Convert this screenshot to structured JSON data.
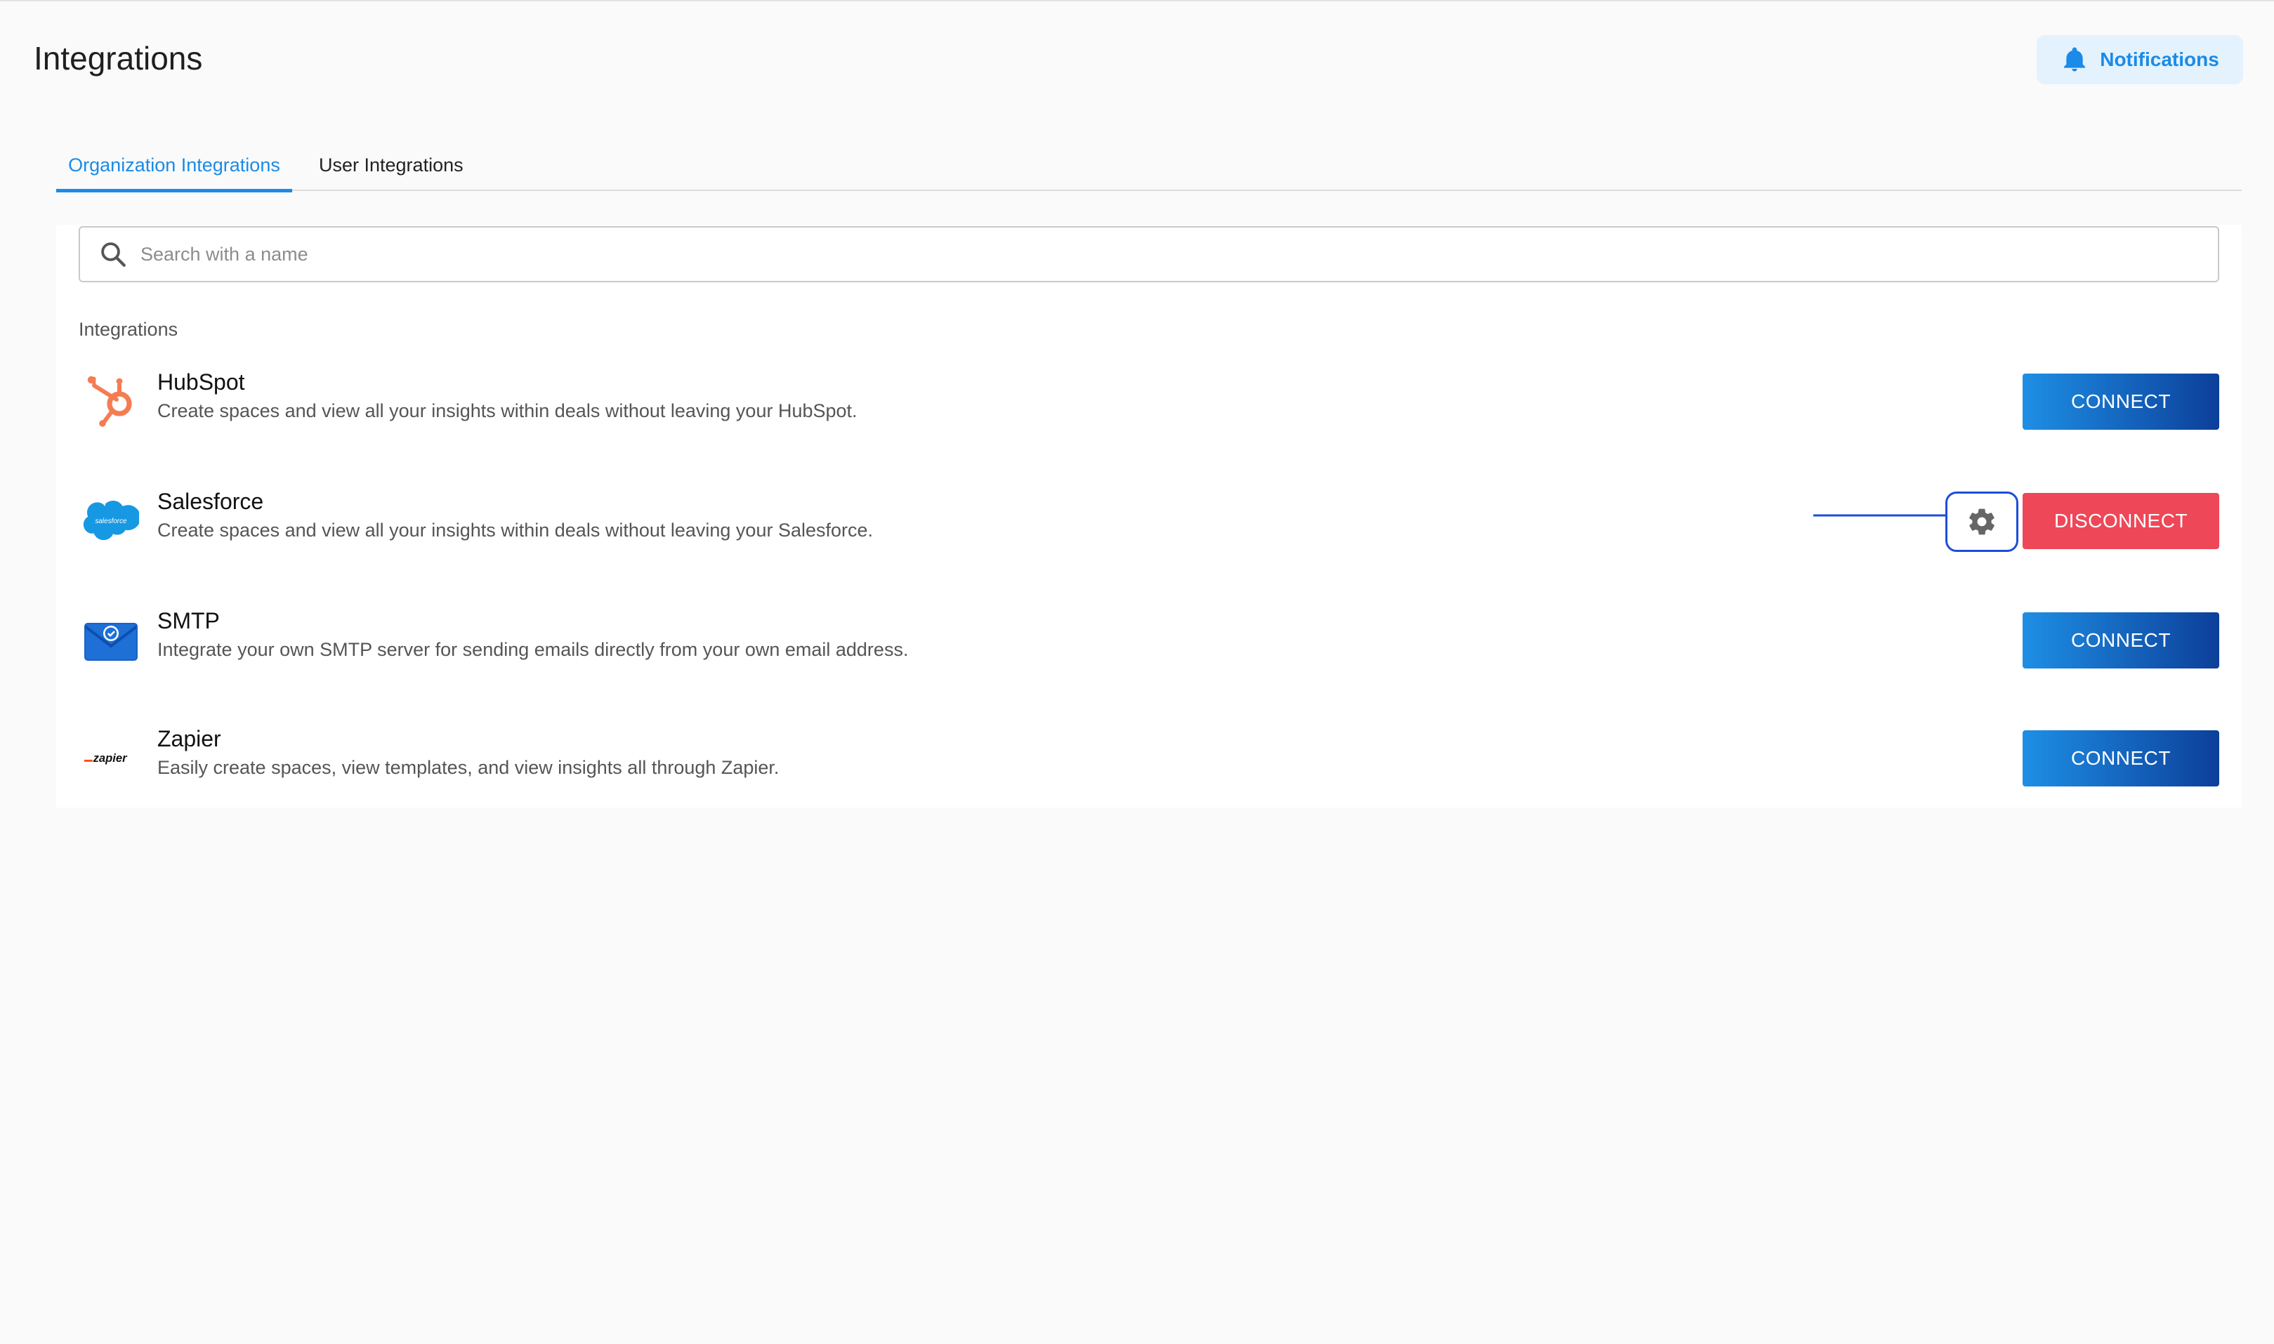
{
  "header": {
    "title": "Integrations",
    "notifications_label": "Notifications"
  },
  "tabs": [
    {
      "label": "Organization Integrations",
      "active": true
    },
    {
      "label": "User Integrations",
      "active": false
    }
  ],
  "search": {
    "placeholder": "Search with a name",
    "value": ""
  },
  "section_label": "Integrations",
  "integrations": [
    {
      "name": "HubSpot",
      "description": "Create spaces and view all your insights within deals without leaving your HubSpot.",
      "action_label": "CONNECT",
      "icon": "hubspot-logo"
    },
    {
      "name": "Salesforce",
      "description": "Create spaces and view all your insights within deals without leaving your Salesforce.",
      "action_label": "DISCONNECT",
      "icon": "salesforce-logo",
      "logo_text": "salesforce",
      "has_settings": true
    },
    {
      "name": "SMTP",
      "description": "Integrate your own SMTP server for sending emails directly from your own email address.",
      "action_label": "CONNECT",
      "icon": "smtp-mail-logo"
    },
    {
      "name": "Zapier",
      "description": "Easily create spaces, view templates, and view insights all through Zapier.",
      "action_label": "CONNECT",
      "icon": "zapier-logo",
      "logo_text": "zapier"
    }
  ],
  "colors": {
    "accent": "#1a8be8",
    "connect_gradient_start": "#1e8fe5",
    "connect_gradient_end": "#0c3f9a",
    "disconnect": "#ee4758",
    "hubspot": "#f57c52",
    "salesforce": "#1798e3"
  }
}
